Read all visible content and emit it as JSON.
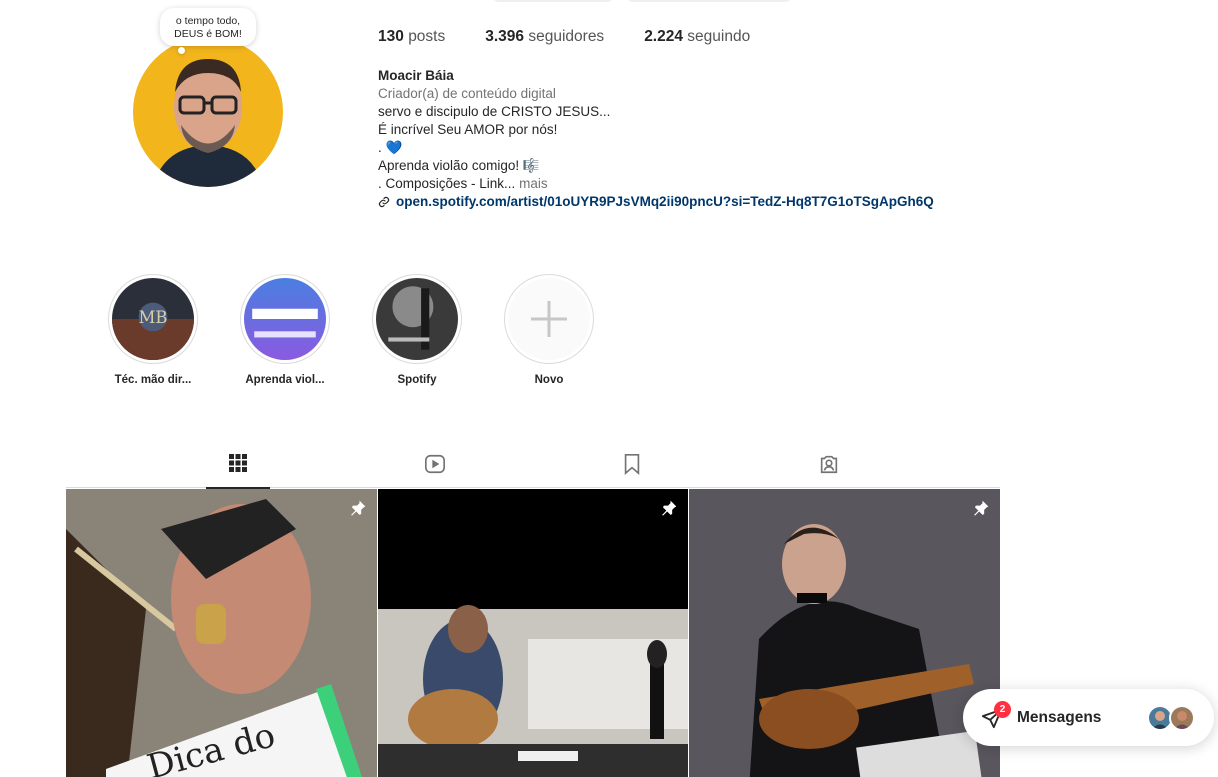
{
  "profile": {
    "note": "o tempo todo, DEUS é BOM!",
    "stats": [
      {
        "value": "130",
        "label": "posts"
      },
      {
        "value": "3.396",
        "label": "seguidores"
      },
      {
        "value": "2.224",
        "label": "seguindo"
      }
    ],
    "name": "Moacir Báia",
    "category": "Criador(a) de conteúdo digital",
    "bio_lines": [
      "servo e discipulo de CRISTO JESUS...",
      "É incrível Seu AMOR por nós!",
      ". 💙",
      "Aprenda violão comigo! 🎼",
      ". Composições - Link..."
    ],
    "more_label": "mais",
    "link": "open.spotify.com/artist/01oUYR9PJsVMq2ii90pncU?si=TedZ-Hq8T7G1oTSgApGh6Q"
  },
  "highlights": [
    {
      "label": "Téc. mão dir..."
    },
    {
      "label": "Aprenda viol..."
    },
    {
      "label": "Spotify"
    },
    {
      "label": "Novo"
    }
  ],
  "tabs": [
    {
      "icon": "grid-icon",
      "active": true
    },
    {
      "icon": "reels-icon",
      "active": false
    },
    {
      "icon": "bookmark-icon",
      "active": false
    },
    {
      "icon": "tagged-icon",
      "active": false
    }
  ],
  "posts": [
    {
      "pinned": true,
      "icon": "pin-icon"
    },
    {
      "pinned": true,
      "icon": "pin-icon"
    },
    {
      "pinned": true,
      "icon": "pin-icon"
    }
  ],
  "messages": {
    "label": "Mensagens",
    "badge": "2"
  },
  "colors": {
    "link": "#00376b",
    "badge": "#ff3040",
    "avatar_bg": "#f2b51c"
  }
}
